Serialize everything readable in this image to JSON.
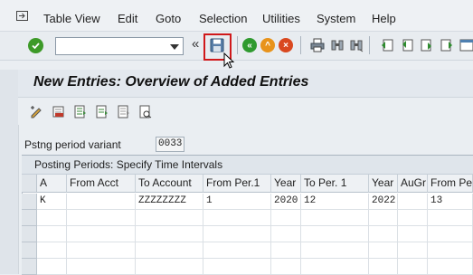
{
  "menubar": {
    "items": [
      "Table View",
      "Edit",
      "Goto",
      "Selection",
      "Utilities",
      "System",
      "Help"
    ],
    "icon": "menu-exit-icon"
  },
  "toolbar": {
    "command_field_value": "",
    "collapse_label": "«",
    "icons": [
      "enter-icon",
      "save-icon",
      "back-icon",
      "exit-icon",
      "cancel-icon",
      "print-icon",
      "find-icon",
      "find-next-icon",
      "first-page-icon",
      "previous-page-icon",
      "next-page-icon",
      "last-page-icon"
    ]
  },
  "page": {
    "title": "New Entries: Overview of Added Entries"
  },
  "app_toolbar": {
    "icons": [
      "change-display-icon",
      "delete-icon",
      "select-all-icon",
      "select-block-icon",
      "deselect-all-icon",
      "details-icon"
    ]
  },
  "field": {
    "label": "Pstng period variant",
    "value": "0033"
  },
  "table": {
    "caption": "Posting Periods: Specify Time Intervals",
    "columns": [
      "A",
      "From Acct",
      "To Account",
      "From Per.1",
      "Year",
      "To Per. 1",
      "Year",
      "AuGr",
      "From Pe"
    ],
    "rows": [
      [
        "K",
        "",
        "ZZZZZZZZ",
        "1",
        "2020",
        "12",
        "2022",
        "",
        "13"
      ],
      [
        "",
        "",
        "",
        "",
        "",
        "",
        "",
        "",
        ""
      ],
      [
        "",
        "",
        "",
        "",
        "",
        "",
        "",
        "",
        ""
      ],
      [
        "",
        "",
        "",
        "",
        "",
        "",
        "",
        "",
        ""
      ],
      [
        "",
        "",
        "",
        "",
        "",
        "",
        "",
        "",
        ""
      ]
    ]
  },
  "colors": {
    "highlight": "#d0181a",
    "ok_green": "#3d9a28",
    "back_orange": "#e8931b",
    "cancel_red": "#d9481f"
  }
}
